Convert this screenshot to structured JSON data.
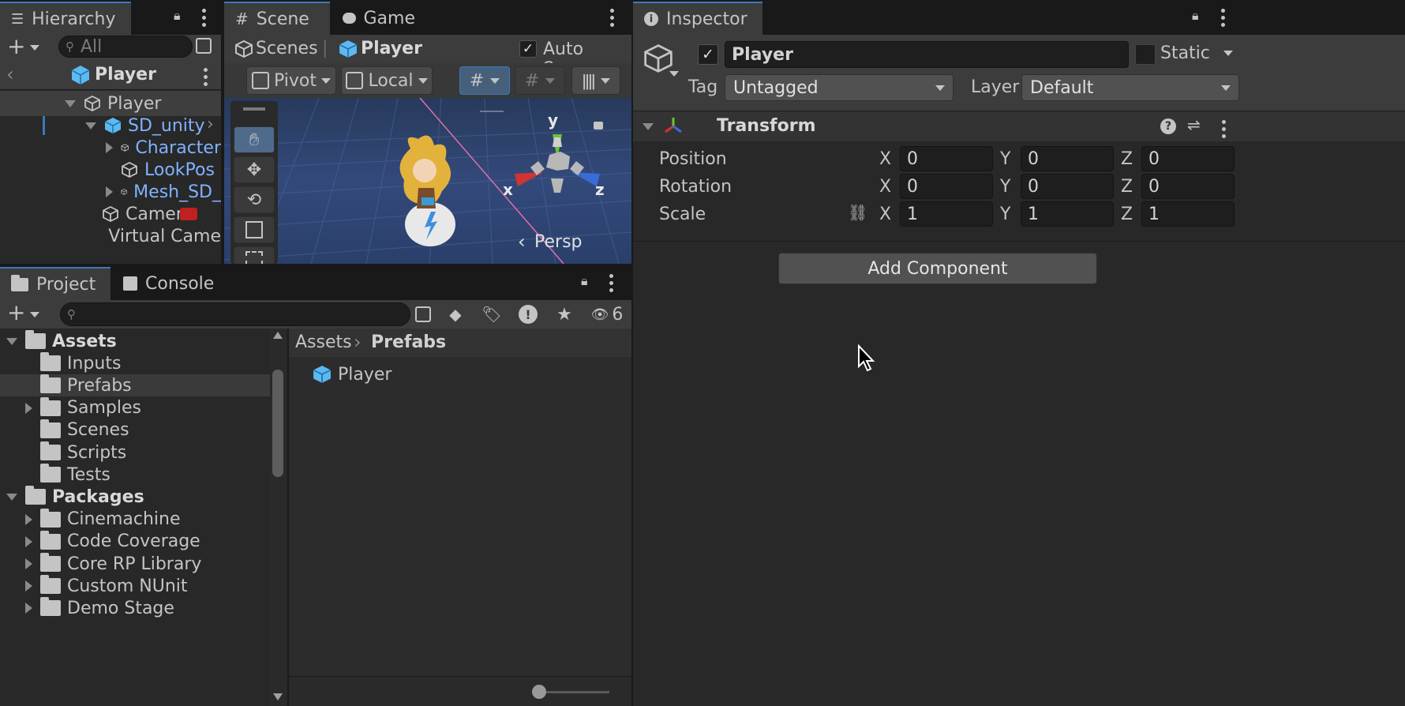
{
  "hierarchy": {
    "tab_label": "Hierarchy",
    "search_placeholder": "All",
    "prefab_header": "Player",
    "items": [
      {
        "label": "Player",
        "style": "root"
      },
      {
        "label": "SD_unity",
        "style": "blue"
      },
      {
        "label": "Character",
        "style": "blue"
      },
      {
        "label": "LookPos",
        "style": "blue"
      },
      {
        "label": "Mesh_SD_",
        "style": "blue"
      },
      {
        "label": "Camera",
        "style": "normal"
      },
      {
        "label": "Virtual Came",
        "style": "normal"
      }
    ]
  },
  "scene": {
    "tabs": [
      "Scene",
      "Game"
    ],
    "breadcrumb": {
      "scenes": "Scenes",
      "current": "Player"
    },
    "auto_save_label": "Auto Save",
    "auto_save_checked": true,
    "pivot_label": "Pivot",
    "local_label": "Local",
    "gizmo": {
      "y": "y",
      "x": "x",
      "z": "z",
      "persp": "Persp"
    }
  },
  "project": {
    "tabs": [
      "Project",
      "Console"
    ],
    "hidden_count": "6",
    "tree": [
      {
        "label": "Assets",
        "level": 0,
        "bold": true,
        "expanded": true
      },
      {
        "label": "Inputs",
        "level": 1
      },
      {
        "label": "Prefabs",
        "level": 1,
        "selected": true
      },
      {
        "label": "Samples",
        "level": 1,
        "has_children": true
      },
      {
        "label": "Scenes",
        "level": 1
      },
      {
        "label": "Scripts",
        "level": 1
      },
      {
        "label": "Tests",
        "level": 1
      },
      {
        "label": "Packages",
        "level": 0,
        "bold": true,
        "expanded": true
      },
      {
        "label": "Cinemachine",
        "level": 1,
        "has_children": true
      },
      {
        "label": "Code Coverage",
        "level": 1,
        "has_children": true
      },
      {
        "label": "Core RP Library",
        "level": 1,
        "has_children": true
      },
      {
        "label": "Custom NUnit",
        "level": 1,
        "has_children": true
      },
      {
        "label": "Demo Stage",
        "level": 1,
        "has_children": true
      }
    ],
    "path": {
      "root": "Assets",
      "current": "Prefabs"
    },
    "files": [
      "Player"
    ]
  },
  "inspector": {
    "tab_label": "Inspector",
    "object_name": "Player",
    "active_checked": true,
    "static_label": "Static",
    "tag_label": "Tag",
    "tag_value": "Untagged",
    "layer_label": "Layer",
    "layer_value": "Default",
    "component_title": "Transform",
    "rows": [
      {
        "label": "Position",
        "x": "0",
        "y": "0",
        "z": "0"
      },
      {
        "label": "Rotation",
        "x": "0",
        "y": "0",
        "z": "0"
      },
      {
        "label": "Scale",
        "x": "1",
        "y": "1",
        "z": "1"
      }
    ],
    "axis": {
      "x": "X",
      "y": "Y",
      "z": "Z"
    },
    "add_component_label": "Add Component"
  },
  "colors": {
    "accent": "#3a79bb",
    "selected_row": "#2c5d87",
    "prefab_blue": "#7fb2ff"
  }
}
